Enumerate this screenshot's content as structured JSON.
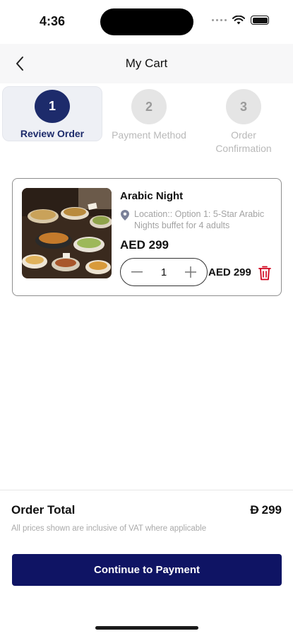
{
  "status_bar": {
    "time": "4:36"
  },
  "header": {
    "title": "My Cart",
    "back_icon": "chevron-left-icon"
  },
  "stepper": {
    "steps": [
      {
        "number": "1",
        "label": "Review Order",
        "state": "active"
      },
      {
        "number": "2",
        "label": "Payment Method",
        "state": "inactive"
      },
      {
        "number": "3",
        "label": "Order Confirmation",
        "state": "inactive"
      }
    ]
  },
  "cart": {
    "items": [
      {
        "name": "Arabic Night",
        "location": "Location:: Option 1: 5-Star Arabic Nights buffet for 4 adults",
        "price": "AED 299",
        "quantity": "1",
        "line_total": "AED 299"
      }
    ]
  },
  "summary": {
    "order_total_label": "Order Total",
    "order_total_currency": "Đ",
    "order_total_value": "299",
    "vat_note": "All prices shown are inclusive of VAT where applicable"
  },
  "actions": {
    "continue_label": "Continue to Payment"
  },
  "colors": {
    "primary": "#1d2b6b",
    "button": "#0f1464",
    "delete": "#d0021b",
    "muted": "#a3a3a3"
  }
}
